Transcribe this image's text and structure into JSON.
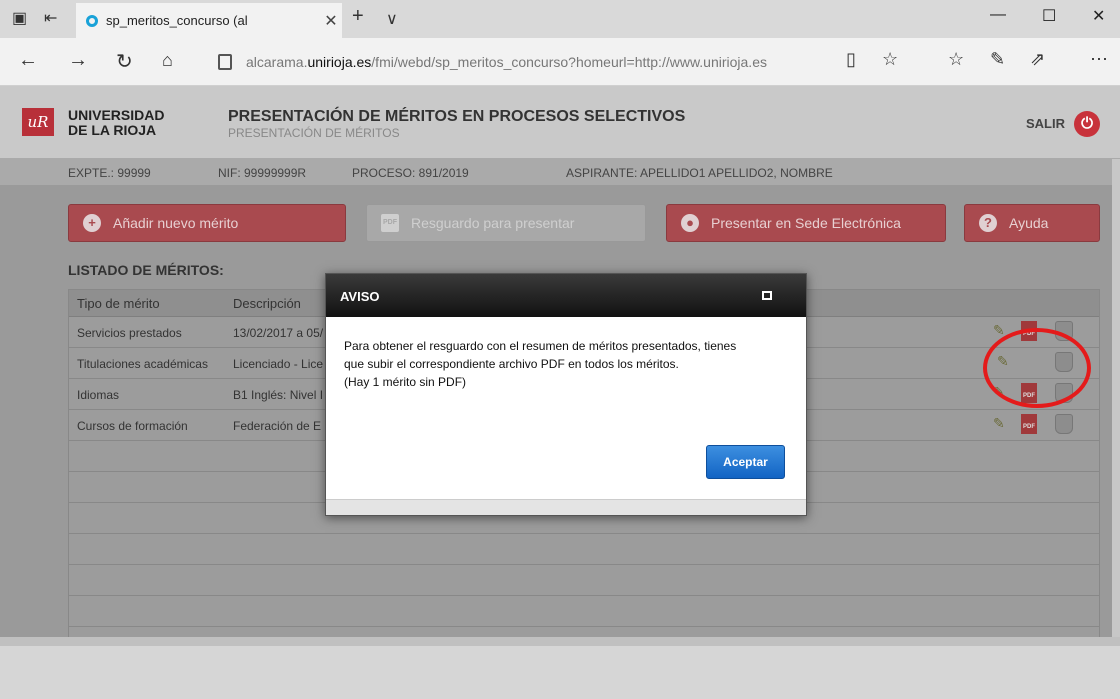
{
  "browser": {
    "tab_title": "sp_meritos_concurso (al",
    "tab_close": "✕",
    "new_tab": "+",
    "tab_list": "∨",
    "url_domain_prefix": "alcarama.",
    "url_domain": "unirioja.es",
    "url_path": "/fmi/webd/sp_meritos_concurso?homeurl=http://www.unirioja.es",
    "window": {
      "minimize": "—",
      "maximize": "☐",
      "close": "✕"
    }
  },
  "header": {
    "logo_text": "uR",
    "university_line1": "UNIVERSIDAD",
    "university_line2": "DE LA RIOJA",
    "title": "PRESENTACIÓN DE MÉRITOS EN PROCESOS SELECTIVOS",
    "subtitle": "PRESENTACIÓN DE MÉRITOS",
    "logout_label": "SALIR"
  },
  "info": {
    "expediente": "EXPTE.: 99999",
    "nif": "NIF: 99999999R",
    "proceso": "PROCESO: 891/2019",
    "aspirante": "ASPIRANTE: APELLIDO1 APELLIDO2, NOMBRE"
  },
  "toolbar": {
    "add_label": "Añadir nuevo mérito",
    "receipt_label": "Resguardo para presentar",
    "submit_label": "Presentar en Sede Electrónica",
    "help_label": "Ayuda"
  },
  "list": {
    "heading": "LISTADO DE MÉRITOS:",
    "col_type": "Tipo de mérito",
    "col_desc": "Descripción",
    "rows": [
      {
        "type": "Servicios prestados",
        "desc": "13/02/2017 a 05/",
        "has_pdf": true
      },
      {
        "type": "Titulaciones académicas",
        "desc": "Licenciado - Lice",
        "has_pdf": false
      },
      {
        "type": "Idiomas",
        "desc": "B1 Inglés: Nivel I",
        "has_pdf": true
      },
      {
        "type": "Cursos de formación",
        "desc": "Federación de E",
        "has_pdf": true
      }
    ],
    "pdf_label": "PDF"
  },
  "modal": {
    "title": "AVISO",
    "line1": "Para obtener el resguardo con el resumen de méritos presentados, tienes",
    "line2": "que subir el correspondiente archivo PDF en todos los méritos.",
    "line3": "(Hay 1 mérito sin PDF)",
    "accept_label": "Aceptar"
  }
}
